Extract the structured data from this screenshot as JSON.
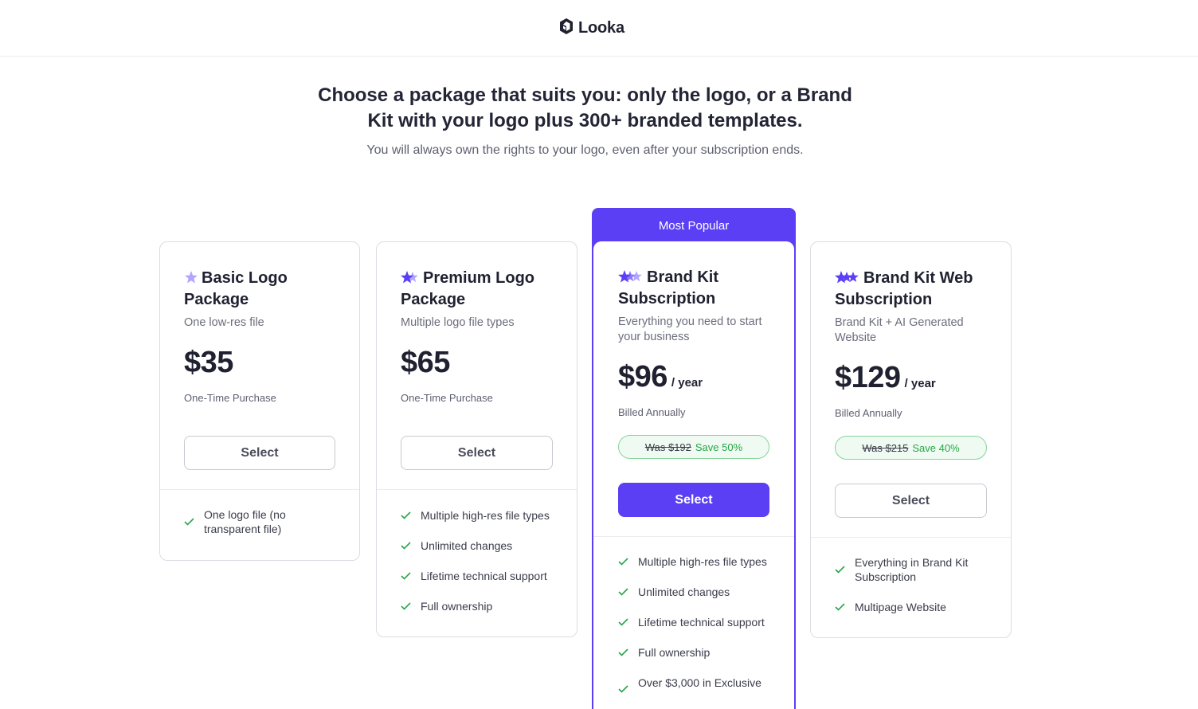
{
  "brand": {
    "name": "Looka"
  },
  "hero": {
    "headline_line1": "Choose a package that suits you: only the logo, or a Brand",
    "headline_line2": "Kit with your logo plus 300+ branded templates.",
    "subheadline": "You will always own the rights to your logo, even after your subscription ends."
  },
  "colors": {
    "accent": "#5a3ff5",
    "success": "#27a548",
    "text": "#232535",
    "star_light": "#b3a5ff"
  },
  "plans": [
    {
      "title_line1": "Basic Logo",
      "title_line2": "Package",
      "stars": 1,
      "tagline_line1": "One low-res file",
      "tagline_line2": "",
      "price": "$35",
      "period": "",
      "billing": "One-Time Purchase",
      "button": "Select",
      "features": [
        {
          "line1": "One logo file (no",
          "line2": "transparent file)"
        }
      ]
    },
    {
      "title_line1": "Premium Logo",
      "title_line2": "Package",
      "stars": 2,
      "tagline_line1": "Multiple logo file types",
      "tagline_line2": "",
      "price": "$65",
      "period": "",
      "billing": "One-Time Purchase",
      "button": "Select",
      "features": [
        {
          "line1": "Multiple high-res file types"
        },
        {
          "line1": "Unlimited changes"
        },
        {
          "line1": "Lifetime technical support"
        },
        {
          "line1": "Full ownership"
        }
      ]
    },
    {
      "badge": "Most Popular",
      "title_line1": "Brand Kit",
      "title_line2": "Subscription",
      "stars": 3,
      "tagline_line1": "Everything you need to start",
      "tagline_line2": "your business",
      "price": "$96",
      "period": "/ year",
      "billing": "Billed Annually",
      "was": "Was $192",
      "save": "Save 50%",
      "button": "Select",
      "features": [
        {
          "line1": "Multiple high-res file types"
        },
        {
          "line1": "Unlimited changes"
        },
        {
          "line1": "Lifetime technical support"
        },
        {
          "line1": "Full ownership"
        },
        {
          "line1": "Over $3,000 in Exclusive"
        }
      ]
    },
    {
      "title_line1": "Brand Kit Web",
      "title_line2": "Subscription",
      "stars": 3,
      "tagline_line1": "Brand Kit + AI Generated",
      "tagline_line2": "Website",
      "price": "$129",
      "period": "/ year",
      "billing": "Billed Annually",
      "was": "Was $215",
      "save": "Save 40%",
      "button": "Select",
      "features": [
        {
          "line1": "Everything in Brand Kit",
          "line2": "Subscription"
        },
        {
          "line1": "Multipage Website"
        }
      ]
    }
  ]
}
